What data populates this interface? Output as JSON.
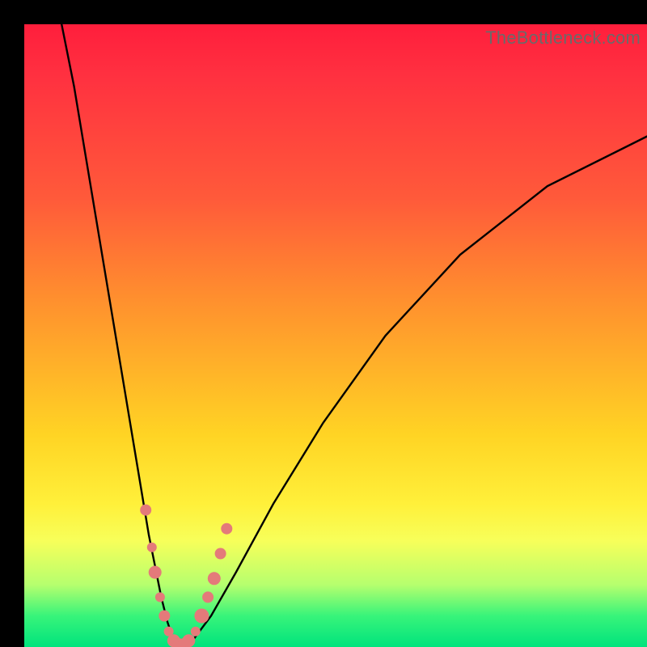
{
  "watermark": "TheBottleneck.com",
  "colors": {
    "gradient_top": "#ff1e3c",
    "gradient_mid1": "#ff8f2e",
    "gradient_mid2": "#fff03a",
    "gradient_bottom": "#00e37d",
    "curve": "#000000",
    "markers": "#e47a7a",
    "frame": "#000000"
  },
  "chart_data": {
    "type": "line",
    "title": "",
    "xlabel": "",
    "ylabel": "",
    "xlim": [
      0,
      100
    ],
    "ylim": [
      0,
      100
    ],
    "grid": false,
    "legend": false,
    "series": [
      {
        "name": "bottleneck-curve",
        "x": [
          6,
          8,
          10,
          12,
          14,
          16,
          18,
          20,
          22,
          23,
          24,
          25,
          26,
          27,
          30,
          34,
          40,
          48,
          58,
          70,
          84,
          100
        ],
        "y": [
          100,
          90,
          78,
          66,
          54,
          42,
          30,
          18,
          8,
          4,
          1,
          0,
          0,
          1,
          5,
          12,
          23,
          36,
          50,
          63,
          74,
          82
        ]
      }
    ],
    "markers": {
      "name": "highlighted-points",
      "x": [
        19.5,
        20.5,
        21,
        21.8,
        22.5,
        23.2,
        24,
        24.8,
        25.6,
        26.4,
        27.5,
        28.5,
        29.5,
        30.5,
        31.5,
        32.5
      ],
      "y": [
        22,
        16,
        12,
        8,
        5,
        2.5,
        1,
        0.5,
        0.5,
        1,
        2.5,
        5,
        8,
        11,
        15,
        19
      ],
      "r": [
        7,
        6,
        8,
        6,
        7,
        6,
        8,
        7,
        7,
        8,
        6,
        9,
        7,
        8,
        7,
        7
      ]
    }
  }
}
